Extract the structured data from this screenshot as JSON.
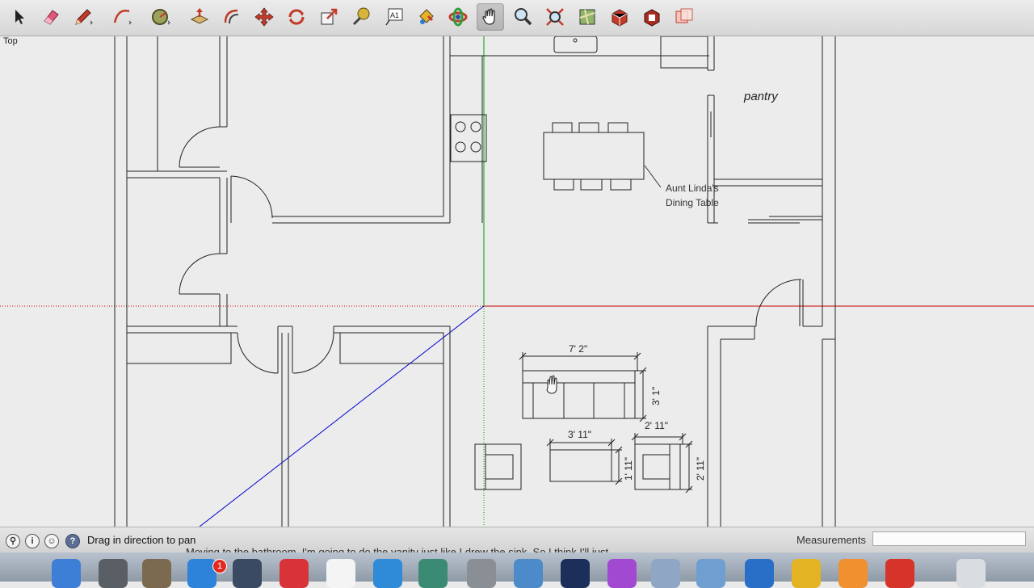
{
  "toolbar": {
    "tools": [
      {
        "name": "select-tool",
        "icon": "arrow-cursor-icon"
      },
      {
        "name": "eraser-tool",
        "icon": "eraser-icon"
      },
      {
        "name": "line-tool",
        "icon": "pencil-icon"
      },
      {
        "name": "arc-tool",
        "icon": "arc-icon"
      },
      {
        "name": "shapes-tool",
        "icon": "circle-icon"
      },
      {
        "name": "push-pull-tool",
        "icon": "push-pull-icon"
      },
      {
        "name": "offset-tool",
        "icon": "offset-icon"
      },
      {
        "name": "move-tool",
        "icon": "move-arrows-icon"
      },
      {
        "name": "rotate-tool",
        "icon": "rotate-icon"
      },
      {
        "name": "scale-tool",
        "icon": "scale-icon"
      },
      {
        "name": "tape-measure-tool",
        "icon": "tape-measure-icon"
      },
      {
        "name": "text-tool",
        "icon": "text-icon"
      },
      {
        "name": "paint-bucket-tool",
        "icon": "paint-bucket-icon"
      },
      {
        "name": "orbit-tool",
        "icon": "orbit-icon"
      },
      {
        "name": "pan-tool",
        "icon": "hand-icon"
      },
      {
        "name": "zoom-tool",
        "icon": "magnifier-icon"
      },
      {
        "name": "zoom-extents-tool",
        "icon": "zoom-extents-icon"
      },
      {
        "name": "map-tool",
        "icon": "map-icon"
      },
      {
        "name": "warehouse-tool",
        "icon": "warehouse-icon"
      },
      {
        "name": "extension-warehouse-tool",
        "icon": "extension-icon"
      },
      {
        "name": "send-to-layout-tool",
        "icon": "layout-icon"
      }
    ],
    "active_tool": "pan-tool"
  },
  "canvas": {
    "view_label": "Top",
    "room_label": "pantry",
    "note_line1": "Aunt Linda's",
    "note_line2": "Dining Table",
    "dimensions": {
      "sofa_width": "7' 2\"",
      "sofa_depth": "3' 1\"",
      "chair_width": "2' 11\"",
      "chair_depth": "2' 11\"",
      "table_width": "3' 11\"",
      "table_depth": "1' 11\""
    }
  },
  "statusbar": {
    "status_text": "Drag in direction to pan",
    "measurements_label": "Measurements",
    "measurements_value": "",
    "subtitle": "Moving to the bathroom, I'm going to do the vanity just like I drew the sink. So I think I'll just"
  },
  "dock": {
    "badge_count": "1",
    "items": [
      {
        "name": "finder",
        "color": "#3d7fd6"
      },
      {
        "name": "launchpad",
        "color": "#5a5f66"
      },
      {
        "name": "app-folder",
        "color": "#7b6a4f"
      },
      {
        "name": "app-store",
        "color": "#2d83d9"
      },
      {
        "name": "time-machine",
        "color": "#3a4a63"
      },
      {
        "name": "itunes",
        "color": "#d9333a"
      },
      {
        "name": "calendar",
        "color": "#f4f4f4"
      },
      {
        "name": "safari",
        "color": "#2f8ad8"
      },
      {
        "name": "photo-app",
        "color": "#3b8a73"
      },
      {
        "name": "system-preferences",
        "color": "#8a8f96"
      },
      {
        "name": "keynote",
        "color": "#4d8ac9"
      },
      {
        "name": "photoshop",
        "color": "#1b2f5a"
      },
      {
        "name": "color-app",
        "color": "#a14ad1"
      },
      {
        "name": "preview",
        "color": "#8fa6c4"
      },
      {
        "name": "screen-app",
        "color": "#6f9fd0"
      },
      {
        "name": "globe-app",
        "color": "#2a6fc7"
      },
      {
        "name": "chrome",
        "color": "#e4b324"
      },
      {
        "name": "pages",
        "color": "#f0902e"
      },
      {
        "name": "sketchup",
        "color": "#d6342b"
      },
      {
        "name": "trash",
        "color": "#d9dde2"
      }
    ]
  },
  "colors": {
    "red_axis": "#cc0000",
    "green_axis": "#00a000",
    "blue_axis": "#0000cc"
  }
}
